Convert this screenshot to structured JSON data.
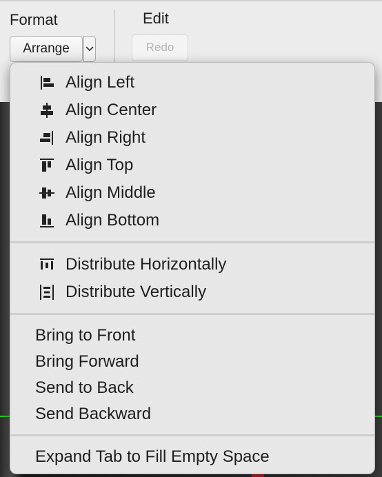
{
  "toolbar": {
    "format_label": "Format",
    "edit_label": "Edit",
    "arrange_button": "Arrange",
    "redo_button": "Redo"
  },
  "menu": {
    "align_items": [
      {
        "label": "Align Left",
        "icon": "align-left-icon"
      },
      {
        "label": "Align Center",
        "icon": "align-center-icon"
      },
      {
        "label": "Align Right",
        "icon": "align-right-icon"
      },
      {
        "label": "Align Top",
        "icon": "align-top-icon"
      },
      {
        "label": "Align Middle",
        "icon": "align-middle-icon"
      },
      {
        "label": "Align Bottom",
        "icon": "align-bottom-icon"
      }
    ],
    "distribute_items": [
      {
        "label": "Distribute Horizontally",
        "icon": "distribute-horizontally-icon"
      },
      {
        "label": "Distribute Vertically",
        "icon": "distribute-vertically-icon"
      }
    ],
    "order_items": [
      {
        "label": "Bring to Front"
      },
      {
        "label": "Bring Forward"
      },
      {
        "label": "Send to Back"
      },
      {
        "label": "Send Backward"
      }
    ],
    "tab_items": [
      {
        "label": "Expand Tab to Fill Empty Space"
      }
    ]
  },
  "colors": {
    "menu_background": "#e7e7e7",
    "guide_line": "#2fd02f"
  }
}
